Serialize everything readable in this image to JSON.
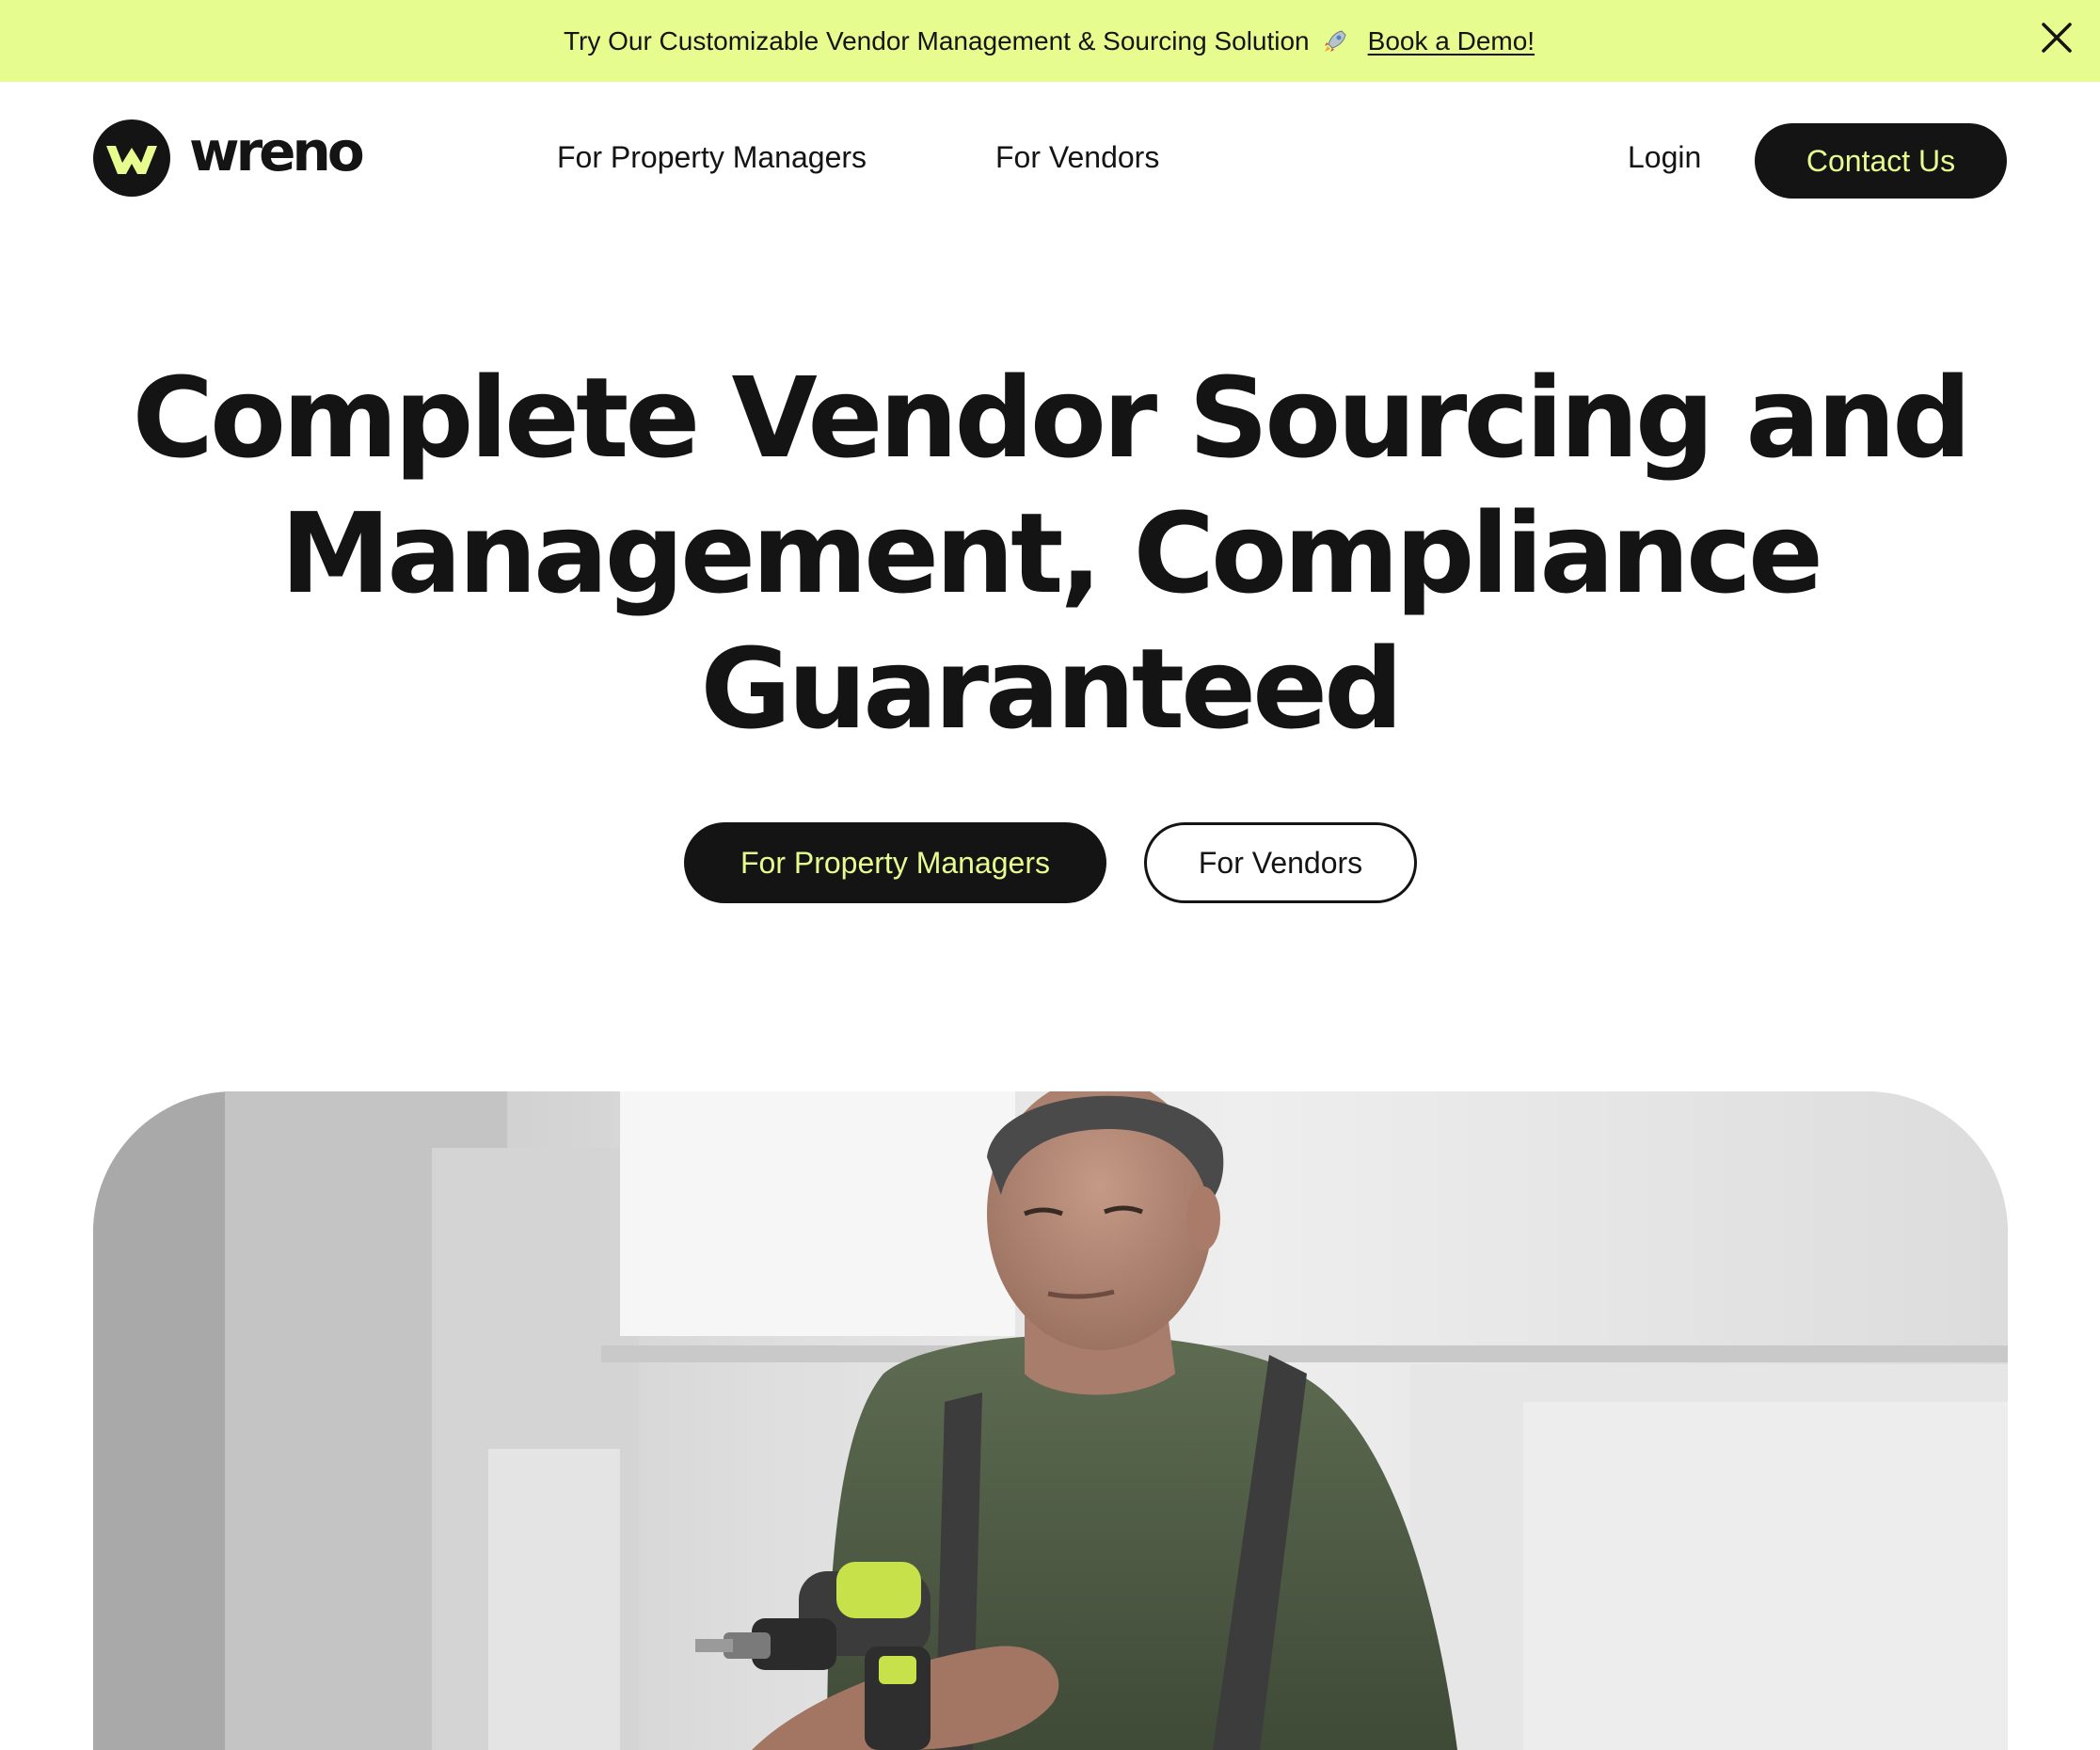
{
  "banner": {
    "text": "Try Our Customizable Vendor Management & Sourcing Solution",
    "rocket_icon": "rocket-icon",
    "link_label": "Book a Demo!",
    "close_icon": "close-icon",
    "background_color": "#e6fc8f"
  },
  "nav": {
    "logo_text": "wreno",
    "links": [
      {
        "label": "For Property Managers"
      },
      {
        "label": "For Vendors"
      }
    ],
    "login_label": "Login",
    "contact_label": "Contact Us"
  },
  "hero": {
    "title_lines": [
      "Complete Vendor Sourcing and",
      "Management, Compliance",
      "Guaranteed"
    ],
    "primary_button": "For Property Managers",
    "secondary_button": "For Vendors",
    "image_icon": "worker-with-drill-photo"
  },
  "colors": {
    "accent": "#e6fc8f",
    "dark": "#141414",
    "background": "#ffffff"
  }
}
